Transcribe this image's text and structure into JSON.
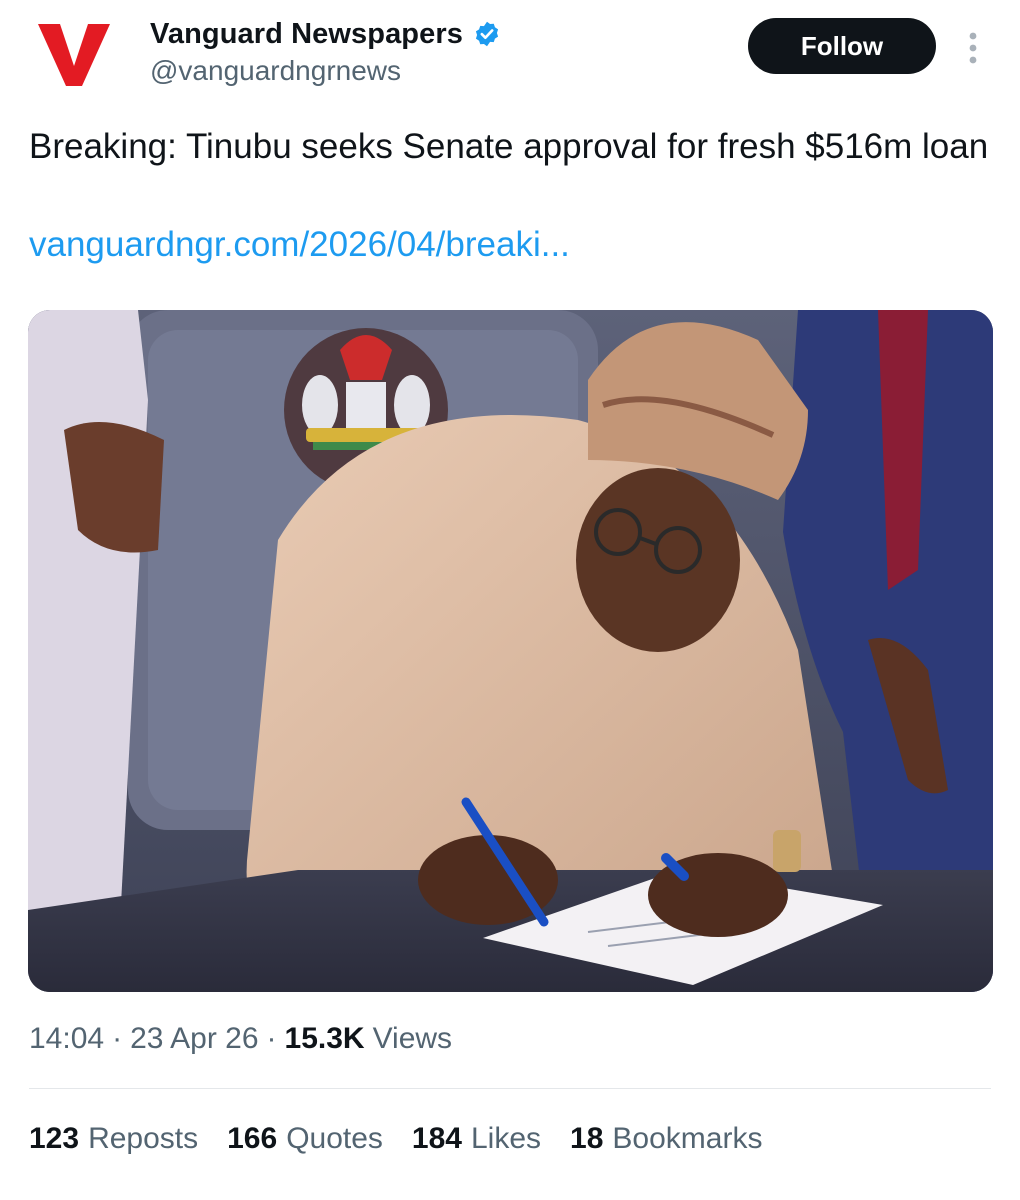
{
  "colors": {
    "brand_red": "#e31b23",
    "verified_blue": "#1d9bf0",
    "link_blue": "#1d9bf0",
    "follow_bg": "#0f1419",
    "secondary_text": "#536471"
  },
  "author": {
    "logo_icon": "vanguard-v-logo",
    "name": "Vanguard Newspapers",
    "verified_icon": "verified-badge-icon",
    "handle": "@vanguardngrnews"
  },
  "actions": {
    "follow_label": "Follow",
    "more_icon": "more-options-icon"
  },
  "tweet": {
    "text": "Breaking: Tinubu seeks Senate approval for fresh $516m loan",
    "link": "vanguardngr.com/2026/04/breaki..."
  },
  "media": {
    "type": "photo",
    "icon": "photo-image"
  },
  "meta": {
    "time": "14:04",
    "date": "23 Apr 26",
    "views_count": "15.3K",
    "views_label": "Views",
    "separator": "·"
  },
  "stats": [
    {
      "count": "123",
      "label": "Reposts"
    },
    {
      "count": "166",
      "label": "Quotes"
    },
    {
      "count": "184",
      "label": "Likes"
    },
    {
      "count": "18",
      "label": "Bookmarks"
    }
  ]
}
